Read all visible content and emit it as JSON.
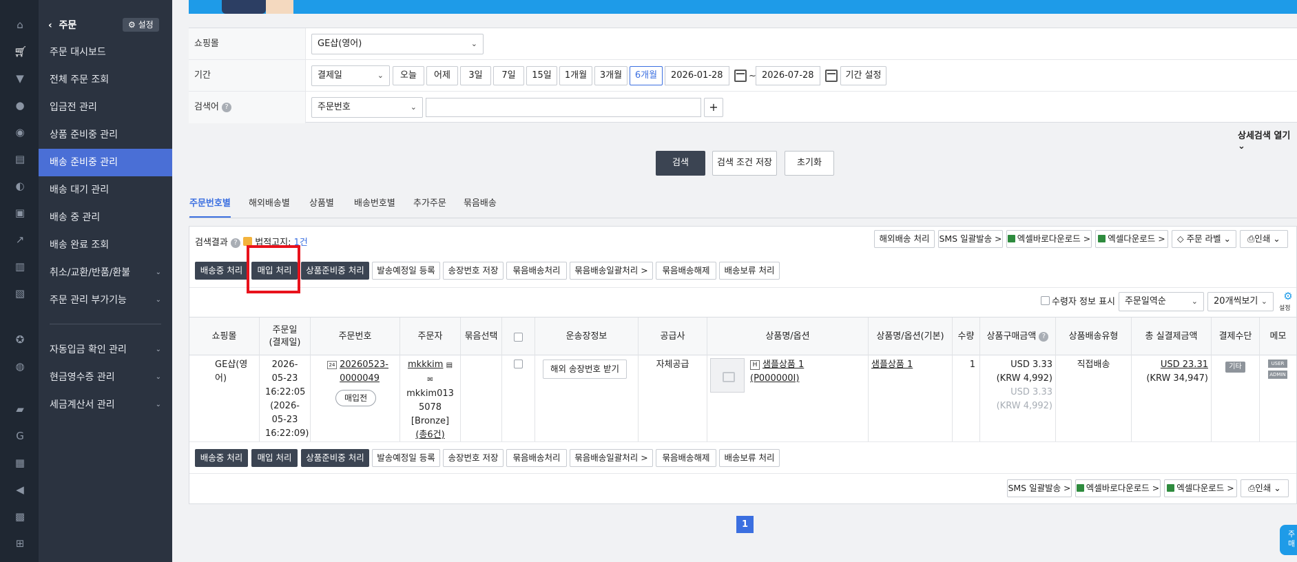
{
  "sidebar": {
    "back_label": "주문",
    "setting_label": "설정",
    "items": [
      {
        "label": "주문 대시보드"
      },
      {
        "label": "전체 주문 조회"
      },
      {
        "label": "입금전 관리"
      },
      {
        "label": "상품 준비중 관리"
      },
      {
        "label": "배송 준비중 관리"
      },
      {
        "label": "배송 대기 관리"
      },
      {
        "label": "배송 중 관리"
      },
      {
        "label": "배송 완료 조회"
      },
      {
        "label": "취소/교환/반품/환불"
      },
      {
        "label": "주문 관리 부가기능"
      },
      {
        "label": "자동입금 확인 관리"
      },
      {
        "label": "현금영수증 관리"
      },
      {
        "label": "세금계산서 관리"
      }
    ],
    "active_index": 4
  },
  "filters": {
    "mall_label": "쇼핑몰",
    "mall_value": "GE샵(영어)",
    "period_label": "기간",
    "period_type": "결제일",
    "period_buttons": [
      "오늘",
      "어제",
      "3일",
      "7일",
      "15일",
      "1개월",
      "3개월",
      "6개월"
    ],
    "period_selected": "6개월",
    "date_from": "2026-01-28",
    "date_tilde": "~",
    "date_to": "2026-07-28",
    "period_setting": "기간 설정",
    "keyword_label": "검색어",
    "keyword_help": "?",
    "keyword_type": "주문번호",
    "keyword_value": "",
    "add_symbol": "+",
    "advanced_label": "상세검색 열기"
  },
  "actions": {
    "search": "검색",
    "save_conditions": "검색 조건 저장",
    "reset": "초기화"
  },
  "tabs": [
    "주문번호별",
    "해외배송별",
    "상품별",
    "배송번호별",
    "추가주문",
    "묶음배송"
  ],
  "results": {
    "label": "검색결과",
    "help": "?",
    "notice_label": "법적고지:",
    "count": "1건",
    "top_right_buttons": [
      "해외배송 처리",
      "SMS 일괄발송 >",
      "엑셀바로다운로드 >",
      "엑셀다운로드 >",
      "주문 라벨",
      "인쇄"
    ],
    "process_buttons": [
      "배송중 처리",
      "매입 처리",
      "상품준비중 처리",
      "발송예정일 등록",
      "송장번호 저장",
      "묶음배송처리",
      "묶음배송일괄처리 >",
      "묶음배송해제",
      "배송보류 처리"
    ],
    "recipient_toggle": "수령자 정보 표시",
    "sort_value": "주문일역순",
    "page_size": "20개씩보기",
    "settings_label": "설정",
    "bottom_right_buttons": [
      "SMS 일괄발송 >",
      "엑셀바로다운로드 >",
      "엑셀다운로드 >",
      "인쇄"
    ]
  },
  "table": {
    "headers": [
      "쇼핑몰",
      "주문일\n(결제일)",
      "주문번호",
      "주문자",
      "묶음선택",
      "",
      "운송장정보",
      "공급사",
      "상품명/옵션",
      "상품명/옵션(기본)",
      "수량",
      "상품구매금액",
      "상품배송유형",
      "총 실결제금액",
      "결제수단",
      "메모"
    ],
    "price_help": "?",
    "row": {
      "mall": "GE샵(영어)",
      "order_date": "2026-05-23 16:22:05",
      "pay_date": "(2026-05-23 16:22:09)",
      "order_no_badge": "24",
      "order_no": "20260523-0000049",
      "status_pill": "매입전",
      "orderer_id": "mkkkim",
      "orderer_phone": "mkkim0135078",
      "orderer_grade": "[Bronze]",
      "orderer_total": "(총6건)",
      "tracking_button": "해외 송장번호 받기",
      "supplier": "자체공급",
      "product_badge": "H",
      "product_name": "샘플상품 1",
      "product_code": "(P000000I)",
      "product_basic": "샘플상품 1",
      "qty": "1",
      "price_usd": "USD 3.33",
      "price_krw": "(KRW 4,992)",
      "price_usd_muted": "USD 3.33",
      "price_krw_muted": "(KRW 4,992)",
      "ship_type": "직접배송",
      "total_usd": "USD 23.31",
      "total_krw": "(KRW 34,947)",
      "pay_method": "기타",
      "memo_user": "USER",
      "memo_admin": "ADMIN"
    }
  },
  "pagination": {
    "current": "1"
  },
  "floating": {
    "text": "주\n매"
  }
}
